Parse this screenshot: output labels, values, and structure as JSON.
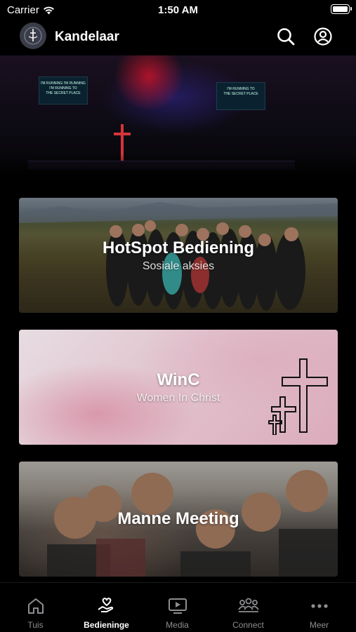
{
  "status_bar": {
    "carrier": "Carrier",
    "time": "1:50 AM"
  },
  "header": {
    "title": "Kandelaar"
  },
  "hero": {
    "screen_left_text": "I'M RUNNING I'M RUNNING\nI'M RUNNING TO\nTHE SECRET PLACE",
    "screen_right_text": "I'M RUNNING TO\nTHE SECRET PLACE"
  },
  "cards": [
    {
      "title": "HotSpot Bediening",
      "subtitle": "Sosiale aksies"
    },
    {
      "title": "WinC",
      "subtitle": "Women In Christ"
    },
    {
      "title": "Manne Meeting",
      "subtitle": ""
    }
  ],
  "tabs": [
    {
      "label": "Tuis",
      "icon": "home-icon",
      "active": false
    },
    {
      "label": "Bedieninge",
      "icon": "hand-heart-icon",
      "active": true
    },
    {
      "label": "Media",
      "icon": "play-screen-icon",
      "active": false
    },
    {
      "label": "Connect",
      "icon": "people-icon",
      "active": false
    },
    {
      "label": "Meer",
      "icon": "more-icon",
      "active": false
    }
  ],
  "colors": {
    "background": "#000000",
    "tab_inactive": "#8e8e93",
    "tab_active": "#ffffff"
  }
}
